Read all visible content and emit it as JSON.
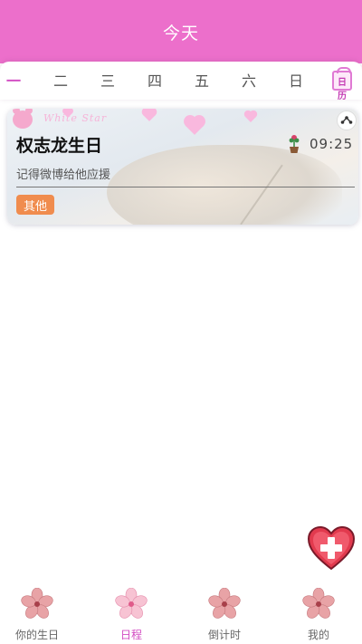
{
  "header": {
    "title": "今天"
  },
  "week": {
    "days": [
      "一",
      "二",
      "三",
      "四",
      "五",
      "六",
      "日"
    ],
    "active_index": 0,
    "calendar_icon_label": "日历"
  },
  "event": {
    "title": "权志龙生日",
    "time": "09:25",
    "note": "记得微博给他应援",
    "tag": "其他",
    "tag_color": "#f08c4e",
    "deco_text": "White Star"
  },
  "bottom_nav": {
    "items": [
      {
        "label": "你的生日",
        "icon": "cherry-blossom-icon",
        "active": false
      },
      {
        "label": "日程",
        "icon": "cherry-blossom-icon",
        "active": true
      },
      {
        "label": "倒计时",
        "icon": "cherry-blossom-icon",
        "active": false
      },
      {
        "label": "我的",
        "icon": "cherry-blossom-icon",
        "active": false
      }
    ]
  },
  "colors": {
    "header": "#ec6fcb",
    "accent": "#d24cc2",
    "tag": "#f08c4e",
    "fab": "#e23a4e"
  }
}
